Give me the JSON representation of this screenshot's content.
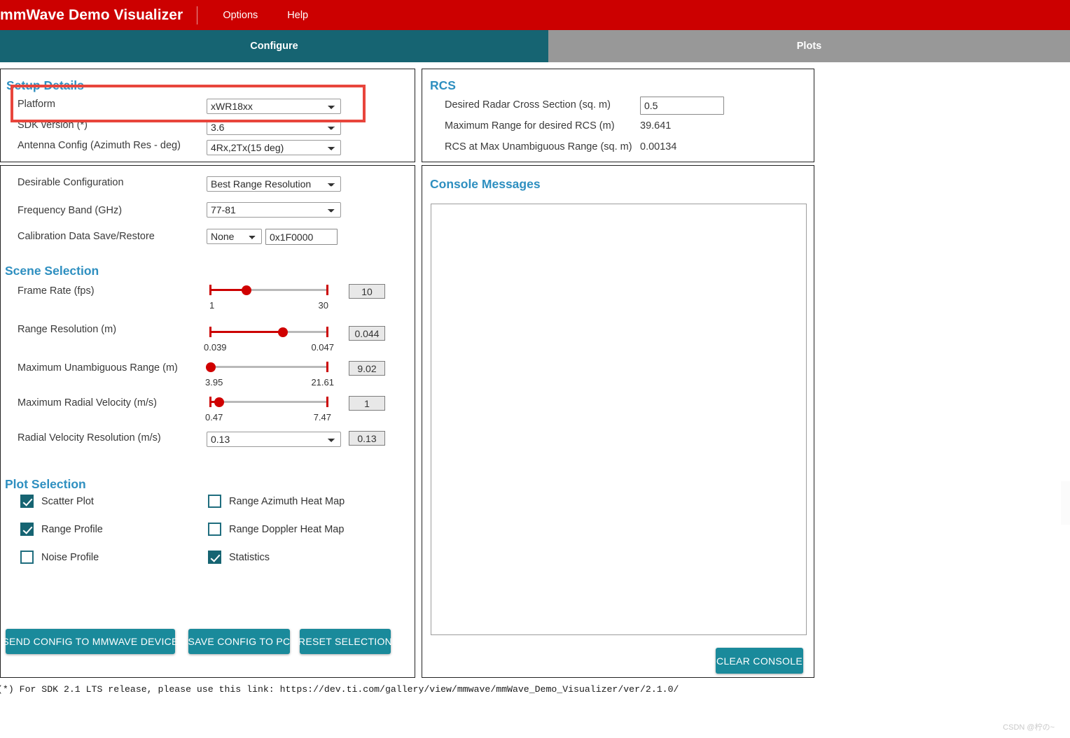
{
  "header": {
    "brand": "mmWave Demo Visualizer",
    "menu": [
      "Options",
      "Help"
    ]
  },
  "tabs": [
    {
      "label": "Configure",
      "active": true
    },
    {
      "label": "Plots",
      "active": false
    }
  ],
  "setup": {
    "title": "Setup Details",
    "rows": [
      {
        "label": "Platform",
        "value": "xWR18xx"
      },
      {
        "label": "SDK version (*)",
        "value": "3.6"
      },
      {
        "label": "Antenna Config (Azimuth Res - deg)",
        "value": "4Rx,2Tx(15 deg)"
      }
    ]
  },
  "config": {
    "rows": [
      {
        "label": "Desirable Configuration",
        "value": "Best Range Resolution"
      },
      {
        "label": "Frequency Band (GHz)",
        "value": "77-81"
      },
      {
        "label": "Calibration Data Save/Restore",
        "value": "None",
        "value2": "0x1F0000"
      }
    ]
  },
  "scene": {
    "title": "Scene Selection",
    "sliders": [
      {
        "label": "Frame Rate (fps)",
        "min": "1",
        "max": "30",
        "value": "10",
        "pct": 31
      },
      {
        "label": "Range Resolution (m)",
        "min": "0.039",
        "max": "0.047",
        "value": "0.044",
        "pct": 62
      },
      {
        "label": "Maximum Unambiguous Range (m)",
        "min": "3.95",
        "max": "21.61",
        "value": "9.02",
        "pct": 0
      },
      {
        "label": "Maximum Radial Velocity (m/s)",
        "min": "0.47",
        "max": "7.47",
        "value": "1",
        "pct": 7
      }
    ],
    "select_row": {
      "label": "Radial Velocity Resolution (m/s)",
      "value": "0.13",
      "boxvalue": "0.13"
    }
  },
  "plot_selection": {
    "title": "Plot Selection",
    "items": [
      {
        "label": "Scatter Plot",
        "checked": true
      },
      {
        "label": "Range Azimuth Heat Map",
        "checked": false
      },
      {
        "label": "Range Profile",
        "checked": true
      },
      {
        "label": "Range Doppler Heat Map",
        "checked": false
      },
      {
        "label": "Noise Profile",
        "checked": false
      },
      {
        "label": "Statistics",
        "checked": true
      }
    ]
  },
  "actions": {
    "send": "SEND CONFIG TO MMWAVE DEVICE",
    "save": "SAVE CONFIG TO PC",
    "reset": "RESET SELECTION"
  },
  "rcs": {
    "title": "RCS",
    "rows": [
      {
        "label": "Desired Radar Cross Section (sq. m)",
        "value": "0.5",
        "input": true
      },
      {
        "label": "Maximum Range for desired RCS (m)",
        "value": "39.641",
        "input": false
      },
      {
        "label": "RCS at Max Unambiguous Range (sq. m)",
        "value": "0.00134",
        "input": false
      }
    ]
  },
  "console": {
    "title": "Console Messages",
    "text": "",
    "clear_label": "CLEAR CONSOLE"
  },
  "footer": {
    "note": "(*) For SDK 2.1 LTS release, please use this link: https://dev.ti.com/gallery/view/mmwave/mmWave_Demo_Visualizer/ver/2.1.0/",
    "watermark": "CSDN @柠の~"
  },
  "colors": {
    "header_red": "#cc0000",
    "tab_teal": "#166472",
    "tab_gray": "#989898",
    "accent_blue": "#2e8fc0",
    "button_teal": "#1a8a9b",
    "slider_red": "#cc0000",
    "highlight_red": "#e8453c"
  }
}
